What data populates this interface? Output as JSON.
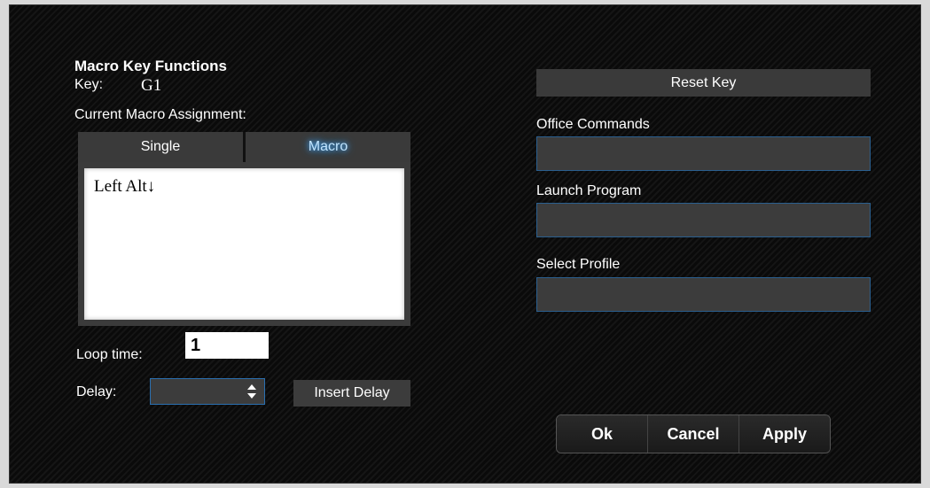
{
  "dialog": {
    "title": "Macro Key Functions",
    "key_label": "Key:",
    "key_value": "G1",
    "assignment_label": "Current Macro Assignment:",
    "tabs": [
      {
        "label": "Single",
        "active": false
      },
      {
        "label": "Macro",
        "active": true
      }
    ],
    "macro_content": "Left Alt↓",
    "loop_time_label": "Loop time:",
    "loop_time_value": "1",
    "delay_label": "Delay:",
    "delay_value": "",
    "insert_delay_label": "Insert Delay"
  },
  "right_panel": {
    "reset_key_label": "Reset Key",
    "office_commands_label": "Office Commands",
    "office_commands_value": "",
    "launch_program_label": "Launch Program",
    "launch_program_value": "",
    "select_profile_label": "Select Profile",
    "select_profile_value": ""
  },
  "footer": {
    "ok_label": "Ok",
    "cancel_label": "Cancel",
    "apply_label": "Apply"
  },
  "colors": {
    "background": "#0d0d0d",
    "panel": "#3a3a3a",
    "field_border": "#2a5f8f",
    "macro_glow": "#4fb3ff"
  }
}
